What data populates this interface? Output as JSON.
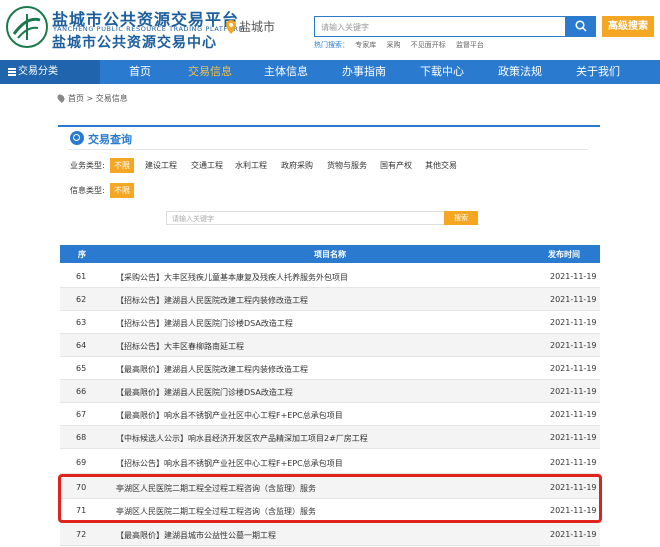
{
  "header": {
    "brand_cn1": "盐城市公共资源交易平台",
    "brand_en": "YANCHENG PUBLIC RESOURCE TRADING PLATFORM",
    "brand_cn2": "盐城市公共资源交易中心",
    "location": "盐城市",
    "search_placeholder": "请输入关键字",
    "advanced_search": "高级搜索",
    "hot_label": "热门搜索：",
    "hot_terms": [
      "专家库",
      "采购",
      "不见面开标",
      "监督平台"
    ]
  },
  "nav": {
    "category": "交易分类",
    "items": [
      "首页",
      "交易信息",
      "主体信息",
      "办事指南",
      "下载中心",
      "政策法规",
      "关于我们"
    ],
    "active": "交易信息"
  },
  "breadcrumb": "首页 > 交易信息",
  "query": {
    "title": "交易查询",
    "business_type_label": "业务类型:",
    "business_types": [
      "不限",
      "建设工程",
      "交通工程",
      "水利工程",
      "政府采购",
      "货物与服务",
      "国有产权",
      "其他交易"
    ],
    "info_type_label": "信息类型:",
    "info_types": [
      "不限"
    ],
    "keyword_placeholder": "请输入关键字",
    "search_button": "搜索"
  },
  "table": {
    "headers": [
      "序",
      "项目名称",
      "发布时间"
    ],
    "rows": [
      {
        "no": "61",
        "name": "【采购公告】大丰区残疾儿童基本康复及残疾人托养服务外包项目",
        "date": "2021-11-19"
      },
      {
        "no": "62",
        "name": "【招标公告】建湖县人民医院改建工程内装修改造工程",
        "date": "2021-11-19"
      },
      {
        "no": "63",
        "name": "【招标公告】建湖县人民医院门诊楼DSA改造工程",
        "date": "2021-11-19"
      },
      {
        "no": "64",
        "name": "【招标公告】大丰区春柳路南延工程",
        "date": "2021-11-19"
      },
      {
        "no": "65",
        "name": "【最高限价】建湖县人民医院改建工程内装修改造工程",
        "date": "2021-11-19"
      },
      {
        "no": "66",
        "name": "【最高限价】建湖县人民医院门诊楼DSA改造工程",
        "date": "2021-11-19"
      },
      {
        "no": "67",
        "name": "【最高限价】响水县不锈钢产业社区中心工程F+EPC总承包项目",
        "date": "2021-11-19"
      },
      {
        "no": "68",
        "name": "【中标候选人公示】响水县经济开发区农产品精深加工项目2#厂房工程",
        "date": "2021-11-19"
      },
      {
        "no": "69",
        "name": "【招标公告】响水县不锈钢产业社区中心工程F+EPC总承包项目",
        "date": "2021-11-19"
      },
      {
        "no": "70",
        "name": "亭湖区人民医院二期工程全过程工程咨询（含监理）服务",
        "date": "2021-11-19"
      },
      {
        "no": "71",
        "name": "亭湖区人民医院二期工程全过程工程咨询（含监理）服务",
        "date": "2021-11-19"
      },
      {
        "no": "72",
        "name": "【最高限价】建湖县城市公益性公墓一期工程",
        "date": "2021-11-19"
      }
    ]
  },
  "colors": {
    "primary": "#2a7bd0",
    "accent": "#f5a623",
    "highlight": "#e0231c"
  }
}
